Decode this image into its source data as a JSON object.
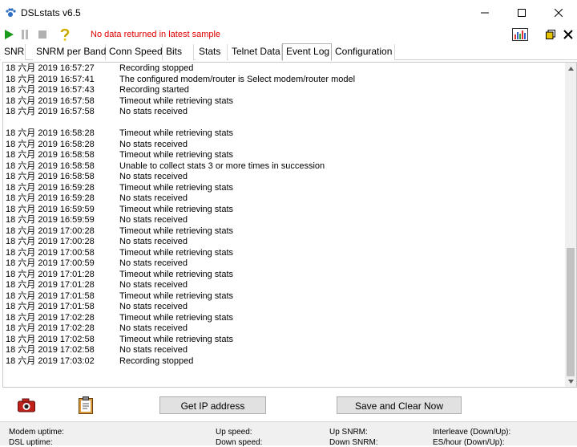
{
  "window": {
    "title": "DSLstats v6.5"
  },
  "toolbar": {
    "status_message": "No data returned in latest sample"
  },
  "tabs": [
    {
      "label": "SNR"
    },
    {
      "label": "SNRM per Band"
    },
    {
      "label": "Conn Speed"
    },
    {
      "label": "Bits"
    },
    {
      "label": "Stats"
    },
    {
      "label": "Telnet Data"
    },
    {
      "label": "Event Log",
      "active": true
    },
    {
      "label": "Configuration"
    }
  ],
  "log": {
    "entries": [
      {
        "ts": "18 六月 2019 16:57:27",
        "msg": "Recording stopped"
      },
      {
        "ts": "18 六月 2019 16:57:41",
        "msg": "The configured modem/router is Select modem/router model"
      },
      {
        "ts": "18 六月 2019 16:57:43",
        "msg": "Recording started"
      },
      {
        "ts": "18 六月 2019 16:57:58",
        "msg": "Timeout while retrieving stats"
      },
      {
        "ts": "18 六月 2019 16:57:58",
        "msg": "No stats received"
      },
      {
        "ts": "",
        "msg": ""
      },
      {
        "ts": "18 六月 2019 16:58:28",
        "msg": "Timeout while retrieving stats"
      },
      {
        "ts": "18 六月 2019 16:58:28",
        "msg": "No stats received"
      },
      {
        "ts": "18 六月 2019 16:58:58",
        "msg": "Timeout while retrieving stats"
      },
      {
        "ts": "18 六月 2019 16:58:58",
        "msg": "Unable to collect stats 3 or more times in succession"
      },
      {
        "ts": "18 六月 2019 16:58:58",
        "msg": "No stats received"
      },
      {
        "ts": "18 六月 2019 16:59:28",
        "msg": "Timeout while retrieving stats"
      },
      {
        "ts": "18 六月 2019 16:59:28",
        "msg": "No stats received"
      },
      {
        "ts": "18 六月 2019 16:59:59",
        "msg": "Timeout while retrieving stats"
      },
      {
        "ts": "18 六月 2019 16:59:59",
        "msg": "No stats received"
      },
      {
        "ts": "18 六月 2019 17:00:28",
        "msg": "Timeout while retrieving stats"
      },
      {
        "ts": "18 六月 2019 17:00:28",
        "msg": "No stats received"
      },
      {
        "ts": "18 六月 2019 17:00:58",
        "msg": "Timeout while retrieving stats"
      },
      {
        "ts": "18 六月 2019 17:00:59",
        "msg": "No stats received"
      },
      {
        "ts": "18 六月 2019 17:01:28",
        "msg": "Timeout while retrieving stats"
      },
      {
        "ts": "18 六月 2019 17:01:28",
        "msg": "No stats received"
      },
      {
        "ts": "18 六月 2019 17:01:58",
        "msg": "Timeout while retrieving stats"
      },
      {
        "ts": "18 六月 2019 17:01:58",
        "msg": "No stats received"
      },
      {
        "ts": "18 六月 2019 17:02:28",
        "msg": "Timeout while retrieving stats"
      },
      {
        "ts": "18 六月 2019 17:02:28",
        "msg": "No stats received"
      },
      {
        "ts": "18 六月 2019 17:02:58",
        "msg": "Timeout while retrieving stats"
      },
      {
        "ts": "18 六月 2019 17:02:58",
        "msg": "No stats received"
      },
      {
        "ts": "18 六月 2019 17:03:02",
        "msg": "Recording stopped"
      }
    ]
  },
  "buttons": {
    "get_ip": "Get IP address",
    "save_clear": "Save and Clear Now"
  },
  "footer": {
    "modem_uptime": "Modem uptime:",
    "dsl_uptime": "DSL uptime:",
    "up_speed": "Up speed:",
    "down_speed": "Down speed:",
    "up_snrm": "Up SNRM:",
    "down_snrm": "Down SNRM:",
    "interleave": "Interleave (Down/Up):",
    "es_hour": "ES/hour (Down/Up):"
  },
  "colors": {
    "status_text": "#e00000",
    "play": "#1a9a1a",
    "accent_yellow": "#e8c400"
  },
  "icons": [
    "app-icon",
    "play-icon",
    "pause-icon",
    "stop-icon",
    "help-icon",
    "chart-icon",
    "restore-icon",
    "close-icon",
    "camera-icon",
    "clipboard-icon"
  ]
}
